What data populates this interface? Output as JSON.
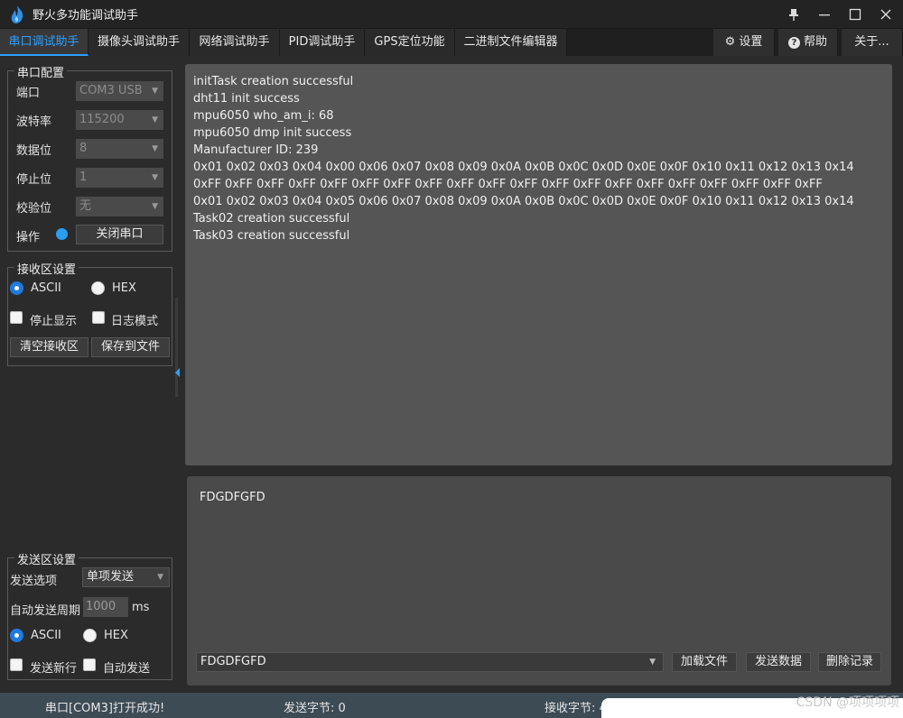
{
  "app": {
    "title": "野火多功能调试助手"
  },
  "window_controls": {
    "pin": "📌",
    "minimize": "—",
    "maximize": "☐",
    "close": "✕"
  },
  "tabs": [
    {
      "label": "串口调试助手",
      "active": true
    },
    {
      "label": "摄像头调试助手"
    },
    {
      "label": "网络调试助手"
    },
    {
      "label": "PID调试助手"
    },
    {
      "label": "GPS定位功能"
    },
    {
      "label": "二进制文件编辑器"
    }
  ],
  "right_tabs": {
    "settings": {
      "icon": "⚙",
      "label": "设置"
    },
    "help": {
      "icon": "?",
      "label": "帮助"
    },
    "about": {
      "label": "关于..."
    }
  },
  "serial_config": {
    "title": "串口配置",
    "port": {
      "label": "端口",
      "value": "COM3 USB"
    },
    "baud": {
      "label": "波特率",
      "value": "115200"
    },
    "databits": {
      "label": "数据位",
      "value": "8"
    },
    "stopbits": {
      "label": "停止位",
      "value": "1"
    },
    "parity": {
      "label": "校验位",
      "value": "无"
    },
    "operation": {
      "label": "操作",
      "button": "关闭串口",
      "led_color": "#2a9df0"
    }
  },
  "recv_settings": {
    "title": "接收区设置",
    "ascii": "ASCII",
    "hex": "HEX",
    "stop_display": "停止显示",
    "log_mode": "日志模式",
    "clear_btn": "清空接收区",
    "save_btn": "保存到文件"
  },
  "send_settings": {
    "title": "发送区设置",
    "option_label": "发送选项",
    "option_value": "单项发送",
    "period_label": "自动发送周期",
    "period_value": "1000",
    "period_unit": "ms",
    "ascii": "ASCII",
    "hex": "HEX",
    "newline": "发送新行",
    "auto_send": "自动发送"
  },
  "receive_lines": [
    "initTask creation successful",
    "dht11 init success",
    "mpu6050 who_am_i: 68",
    "mpu6050 dmp init success",
    "Manufacturer ID: 239",
    "0x01 0x02 0x03 0x04 0x00 0x06 0x07 0x08 0x09 0x0A 0x0B 0x0C 0x0D 0x0E 0x0F 0x10 0x11 0x12 0x13 0x14",
    "0xFF 0xFF 0xFF 0xFF 0xFF 0xFF 0xFF 0xFF 0xFF 0xFF 0xFF 0xFF 0xFF 0xFF 0xFF 0xFF 0xFF 0xFF 0xFF 0xFF",
    "0x01 0x02 0x03 0x04 0x05 0x06 0x07 0x08 0x09 0x0A 0x0B 0x0C 0x0D 0x0E 0x0F 0x10 0x11 0x12 0x13 0x14",
    "Task02 creation successful",
    "Task03 creation successful"
  ],
  "send_area": {
    "text": "FDGDFGFD",
    "history_value": "FDGDFGFD",
    "load_file_btn": "加载文件",
    "send_btn": "发送数据",
    "delete_btn": "删除记录"
  },
  "status": {
    "message": "串口[COM3]打开成功!",
    "sent": "发送字节: 0",
    "received": "接收字节: 4"
  },
  "watermark": "CSDN @项项项项"
}
